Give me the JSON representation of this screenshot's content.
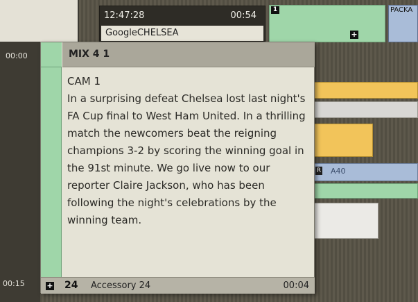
{
  "timeline": {
    "start_time": "00:00",
    "end_time": "00:15"
  },
  "header": {
    "clock": "12:47:28",
    "duration": "00:54",
    "name": "GoogleCHELSEA"
  },
  "blocks": {
    "story_badge": "1",
    "package_label": "PACKA",
    "blue_badge": "R",
    "blue_label": "A40"
  },
  "popup": {
    "title": "MIX 4 1",
    "camera": "CAM 1",
    "story_text": "In a surprising defeat Chelsea lost last night's FA Cup final to West Ham United. In a thrilling match the newcomers beat the reigning champions 3-2 by scoring the winning goal in the 91st minute. We go live now to our reporter Claire Jackson, who has been following the night's celebrations by the winning team.",
    "footer": {
      "number": "24",
      "name": "Accessory 24",
      "duration": "00:04"
    }
  },
  "colors": {
    "green": "#9fd6a9",
    "yellow": "#f2c45a",
    "blue": "#a9bcd8",
    "popup_bg": "#e5e3d6"
  },
  "icons": {
    "expand": "plus-icon"
  }
}
